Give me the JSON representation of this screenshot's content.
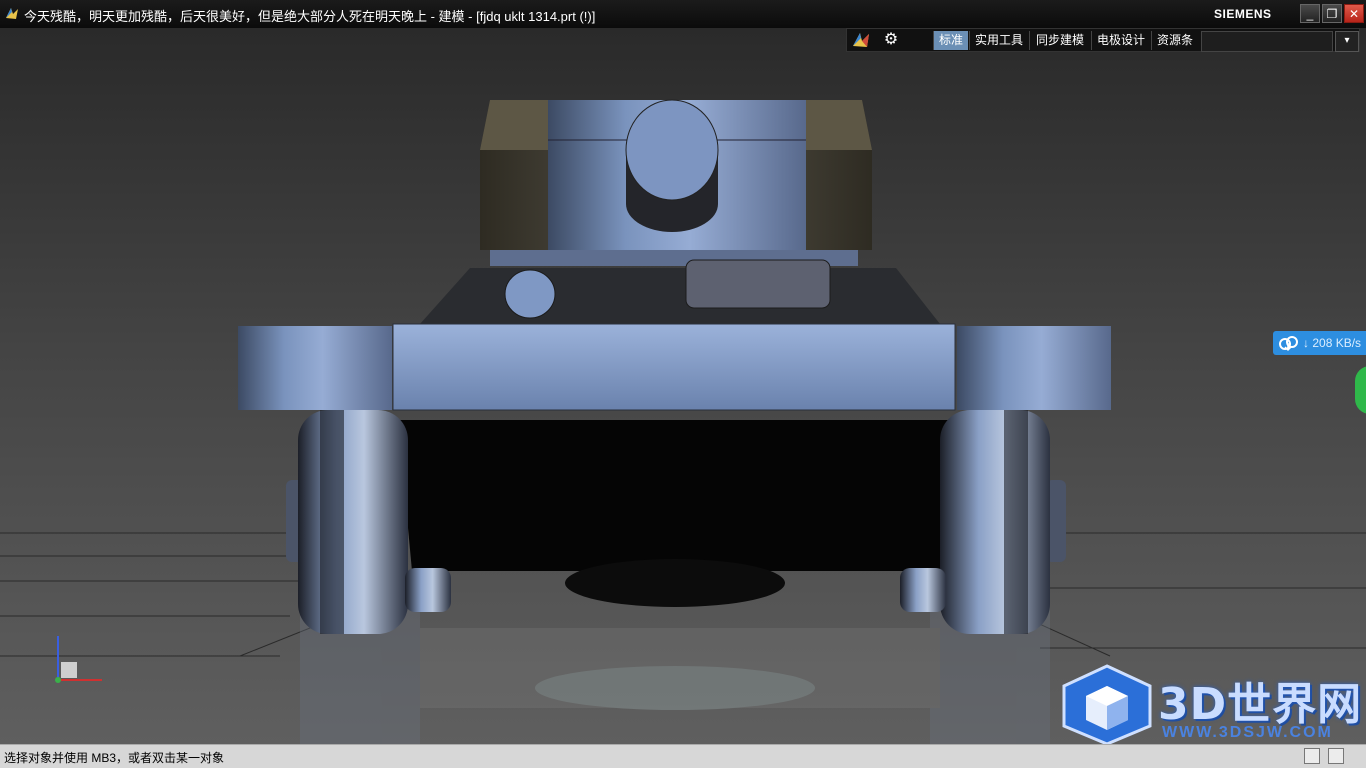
{
  "window": {
    "title": "今天残酷，明天更加残酷，后天很美好，但是绝大部分人死在明天晚上 - 建模 - [fjdq uklt 1314.prt   (!)]",
    "brand": "SIEMENS",
    "minimize_label": "_",
    "maximize_label": "❐",
    "close_label": "✕"
  },
  "ribbon": {
    "tabs": [
      {
        "label": "标准",
        "active": true
      },
      {
        "label": "实用工具",
        "active": false
      },
      {
        "label": "同步建模",
        "active": false
      },
      {
        "label": "电极设计",
        "active": false
      },
      {
        "label": "资源条",
        "active": false
      }
    ],
    "gear_icon": "⚙",
    "dropdown_icon": "▾"
  },
  "download_widget": {
    "speed": "208 KB/s",
    "icon": "cloud-download-icon"
  },
  "status": {
    "text": "选择对象并使用 MB3，或者双击某一对象"
  },
  "watermark": {
    "text": "3D世界网",
    "url": "WWW.3DSJW.COM"
  },
  "colors": {
    "active_tab": "#6b8fb5",
    "download_widget": "#2d8ee0",
    "close_button": "#c7352a"
  }
}
